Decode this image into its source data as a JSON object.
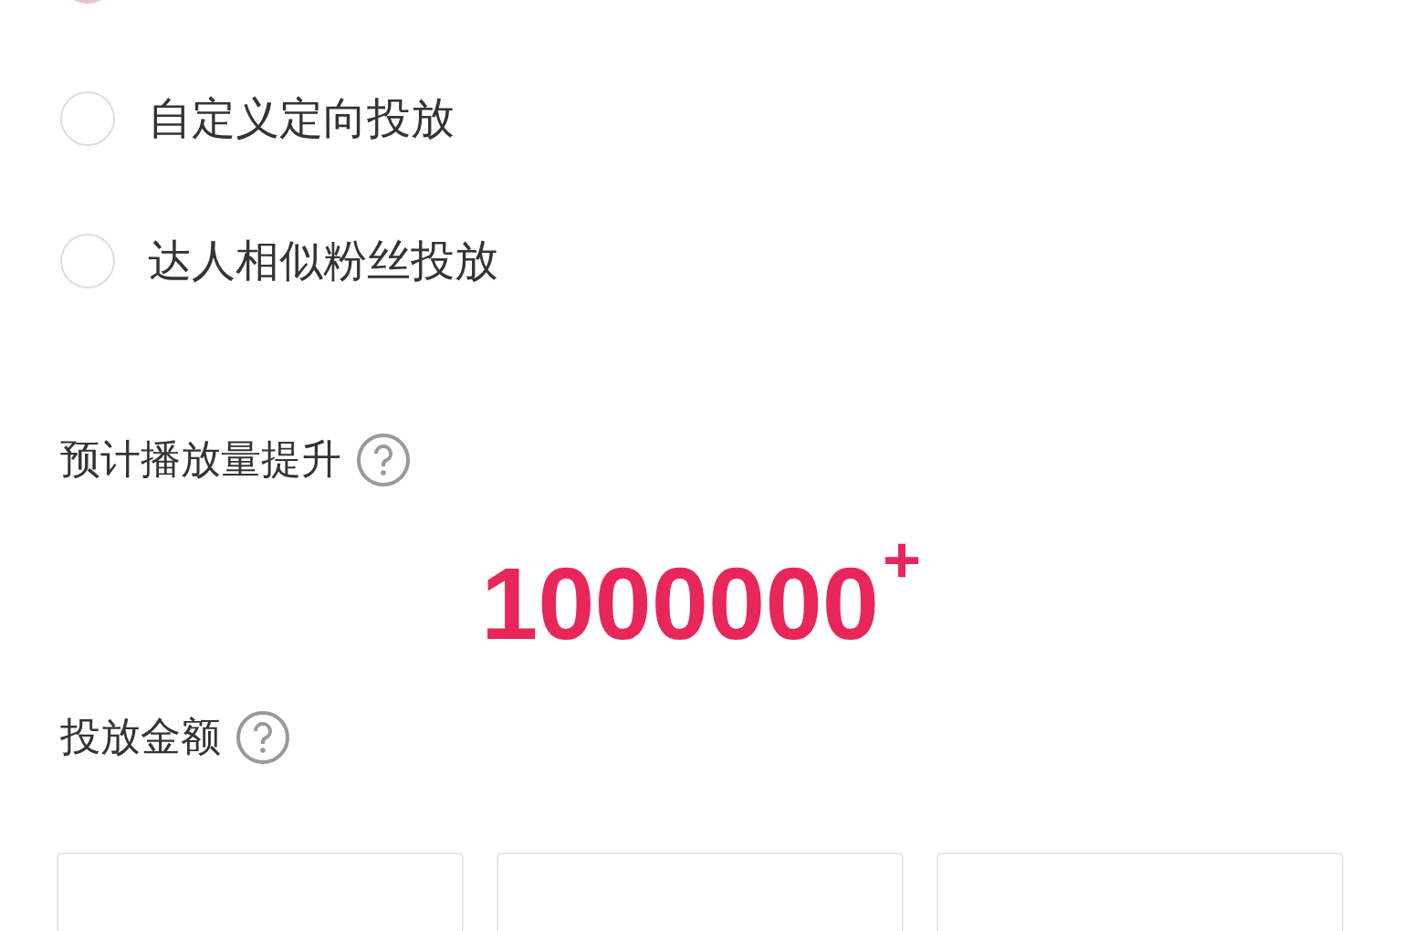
{
  "targeting_options": [
    {
      "selected": true
    },
    {
      "label": "自定义定向投放",
      "selected": false
    },
    {
      "label": "达人相似粉丝投放",
      "selected": false
    }
  ],
  "estimate": {
    "title": "预计播放量提升",
    "value": "1000000",
    "suffix": "+"
  },
  "amount": {
    "title": "投放金额",
    "options": [
      {
        "selected": false
      },
      {
        "selected": false
      },
      {
        "selected": false
      }
    ]
  }
}
